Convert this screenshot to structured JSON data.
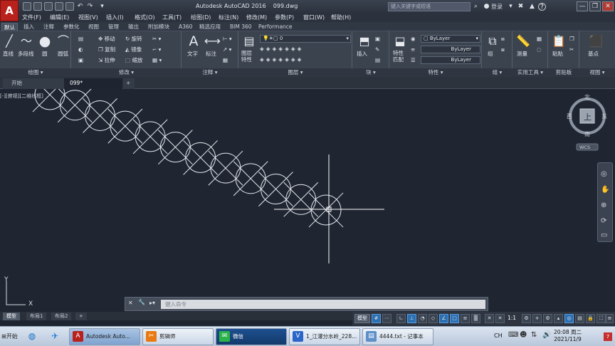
{
  "app": {
    "logo": "A",
    "title": "Autodesk AutoCAD 2016",
    "file": "099.dwg"
  },
  "titlebar": {
    "search_placeholder": "键入关键字或短语",
    "login": "登录",
    "help_icon": "?",
    "win_min": "—",
    "win_restore": "❐",
    "win_close": "✕"
  },
  "menu": [
    "文件(F)",
    "编辑(E)",
    "视图(V)",
    "插入(I)",
    "格式(O)",
    "工具(T)",
    "绘图(D)",
    "标注(N)",
    "修改(M)",
    "参数(P)",
    "窗口(W)",
    "帮助(H)"
  ],
  "ribbon_tabs": [
    "默认",
    "插入",
    "注释",
    "参数化",
    "视图",
    "管理",
    "输出",
    "附加模块",
    "A360",
    "精选应用",
    "BIM 360",
    "Performance"
  ],
  "panels": {
    "draw": {
      "title": "绘图 ▾",
      "line": "直线",
      "polyline": "多段线",
      "circle": "圆",
      "arc": "圆弧"
    },
    "modify": {
      "title": "修改 ▾",
      "move": "移动",
      "rotate": "旋转",
      "copy": "复制",
      "mirror": "镜像",
      "stretch": "拉伸",
      "scale": "缩放"
    },
    "annotation": {
      "title": "注释 ▾",
      "text": "文字",
      "dimension": "标注"
    },
    "layers": {
      "title": "图层 ▾",
      "props": "图层\n特性",
      "current_layer": "0"
    },
    "block": {
      "title": "块 ▾",
      "insert": "插入"
    },
    "properties": {
      "title": "特性 ▾",
      "match": "特性\n匹配",
      "color": "ByLayer",
      "linetype": "ByLayer",
      "lineweight": "ByLayer"
    },
    "groups": {
      "title": "组 ▾",
      "group": "组"
    },
    "utilities": {
      "title": "实用工具 ▾",
      "measure": "测量"
    },
    "clipboard": {
      "title": "剪贴板",
      "paste": "粘贴"
    },
    "view": {
      "title": "视图 ▾",
      "base": "基点"
    }
  },
  "doc_tabs": {
    "start": "开始",
    "file": "099*",
    "add": "+"
  },
  "viewport_label": "[-][俯视][二维线框]",
  "viewcube": {
    "north": "北",
    "south": "南",
    "east": "东",
    "west": "西",
    "top": "上",
    "wcs": "WCS"
  },
  "ucs": {
    "x": "X",
    "y": "Y"
  },
  "command": {
    "placeholder": "键入命令",
    "close_icon": "✕",
    "wrench_icon": "🔧"
  },
  "layout_tabs": [
    "模型",
    "布局1",
    "布局2"
  ],
  "layout_add": "+",
  "status": {
    "model": "模型",
    "scale": "1:1"
  },
  "taskbar": {
    "start": "开始",
    "items": [
      "Autodesk Auto...",
      "剪辑师",
      "微信",
      "1_江灌分水岭_228...",
      "4444.txt - 记事本"
    ],
    "ime": "CH",
    "time": "20:08",
    "weekday": "周二",
    "date": "2021/11/9"
  }
}
